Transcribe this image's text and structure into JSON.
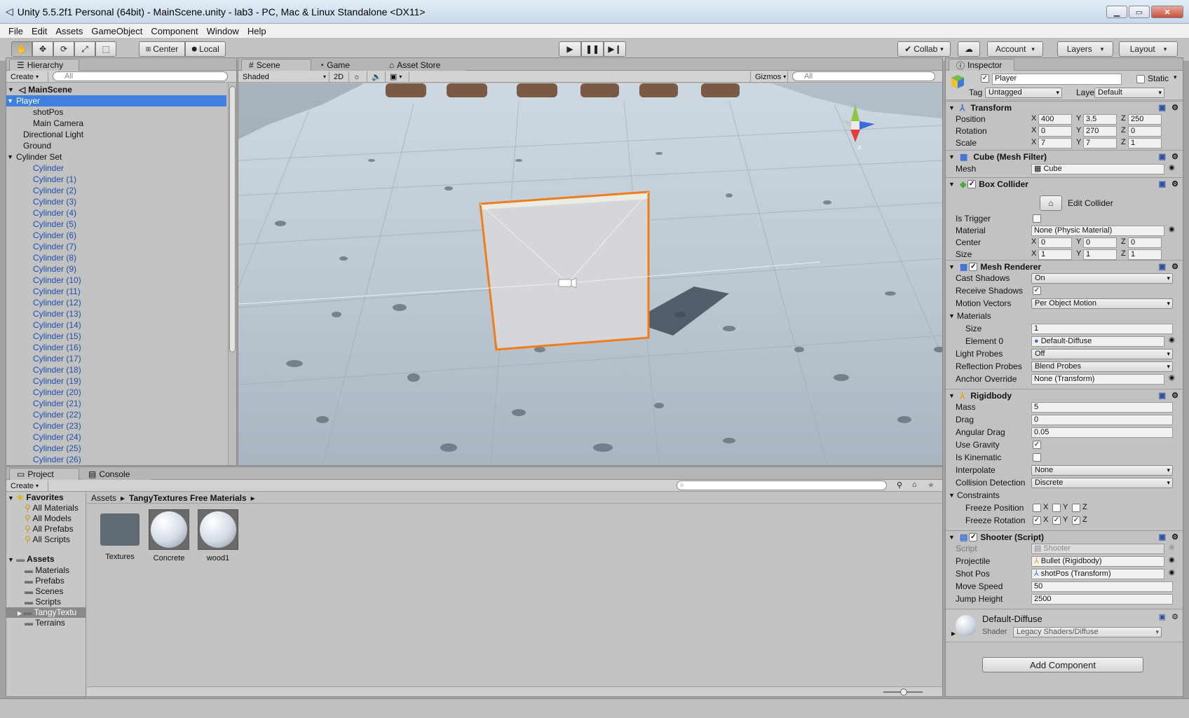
{
  "window": {
    "title": "Unity 5.5.2f1 Personal (64bit) - MainScene.unity - lab3 - PC, Mac & Linux Standalone <DX11>"
  },
  "menu": [
    "File",
    "Edit",
    "Assets",
    "GameObject",
    "Component",
    "Window",
    "Help"
  ],
  "toolbar": {
    "center": "Center",
    "local": "Local",
    "collab": "Collab",
    "account": "Account",
    "layers": "Layers",
    "layout": "Layout"
  },
  "hierarchy": {
    "tab": "Hierarchy",
    "create": "Create",
    "search_placeholder": "All",
    "scene": "MainScene",
    "items": [
      {
        "label": "Player",
        "indent": 1,
        "selected": true,
        "expanded": true
      },
      {
        "label": "shotPos",
        "indent": 2
      },
      {
        "label": "Main Camera",
        "indent": 2
      },
      {
        "label": "Directional Light",
        "indent": 1
      },
      {
        "label": "Ground",
        "indent": 1
      },
      {
        "label": "Cylinder Set",
        "indent": 1,
        "expanded": true
      },
      {
        "label": "Cylinder",
        "indent": 2,
        "prefab": true
      },
      {
        "label": "Cylinder (1)",
        "indent": 2,
        "prefab": true
      },
      {
        "label": "Cylinder (2)",
        "indent": 2,
        "prefab": true
      },
      {
        "label": "Cylinder (3)",
        "indent": 2,
        "prefab": true
      },
      {
        "label": "Cylinder (4)",
        "indent": 2,
        "prefab": true
      },
      {
        "label": "Cylinder (5)",
        "indent": 2,
        "prefab": true
      },
      {
        "label": "Cylinder (6)",
        "indent": 2,
        "prefab": true
      },
      {
        "label": "Cylinder (7)",
        "indent": 2,
        "prefab": true
      },
      {
        "label": "Cylinder (8)",
        "indent": 2,
        "prefab": true
      },
      {
        "label": "Cylinder (9)",
        "indent": 2,
        "prefab": true
      },
      {
        "label": "Cylinder (10)",
        "indent": 2,
        "prefab": true
      },
      {
        "label": "Cylinder (11)",
        "indent": 2,
        "prefab": true
      },
      {
        "label": "Cylinder (12)",
        "indent": 2,
        "prefab": true
      },
      {
        "label": "Cylinder (13)",
        "indent": 2,
        "prefab": true
      },
      {
        "label": "Cylinder (14)",
        "indent": 2,
        "prefab": true
      },
      {
        "label": "Cylinder (15)",
        "indent": 2,
        "prefab": true
      },
      {
        "label": "Cylinder (16)",
        "indent": 2,
        "prefab": true
      },
      {
        "label": "Cylinder (17)",
        "indent": 2,
        "prefab": true
      },
      {
        "label": "Cylinder (18)",
        "indent": 2,
        "prefab": true
      },
      {
        "label": "Cylinder (19)",
        "indent": 2,
        "prefab": true
      },
      {
        "label": "Cylinder (20)",
        "indent": 2,
        "prefab": true
      },
      {
        "label": "Cylinder (21)",
        "indent": 2,
        "prefab": true
      },
      {
        "label": "Cylinder (22)",
        "indent": 2,
        "prefab": true
      },
      {
        "label": "Cylinder (23)",
        "indent": 2,
        "prefab": true
      },
      {
        "label": "Cylinder (24)",
        "indent": 2,
        "prefab": true
      },
      {
        "label": "Cylinder (25)",
        "indent": 2,
        "prefab": true
      },
      {
        "label": "Cylinder (26)",
        "indent": 2,
        "prefab": true
      }
    ]
  },
  "scene": {
    "tabs": [
      "Scene",
      "Game",
      "Asset Store"
    ],
    "shading": "Shaded",
    "mode2d": "2D",
    "gizmos": "Gizmos",
    "search_placeholder": "All"
  },
  "project": {
    "tabs": [
      "Project",
      "Console"
    ],
    "create": "Create",
    "favorites_label": "Favorites",
    "favorites": [
      "All Materials",
      "All Models",
      "All Prefabs",
      "All Scripts"
    ],
    "assets_label": "Assets",
    "folders": [
      "Materials",
      "Prefabs",
      "Scenes",
      "Scripts",
      "TangyTextu",
      "Terrains"
    ],
    "breadcrumb": [
      "Assets",
      "TangyTextures Free Materials"
    ],
    "items": [
      {
        "label": "Textures",
        "kind": "folder"
      },
      {
        "label": "Concrete",
        "kind": "material"
      },
      {
        "label": "wood1",
        "kind": "material"
      }
    ]
  },
  "inspector": {
    "tab": "Inspector",
    "object": {
      "name": "Player",
      "static": "Static",
      "tag_label": "Tag",
      "tag": "Untagged",
      "layer_label": "Layer",
      "layer": "Default"
    },
    "transform": {
      "title": "Transform",
      "rows": [
        {
          "label": "Position",
          "x": "400",
          "y": "3.5",
          "z": "250"
        },
        {
          "label": "Rotation",
          "x": "0",
          "y": "270",
          "z": "0"
        },
        {
          "label": "Scale",
          "x": "7",
          "y": "7",
          "z": "1"
        }
      ]
    },
    "mesh_filter": {
      "title": "Cube (Mesh Filter)",
      "mesh_label": "Mesh",
      "mesh": "Cube"
    },
    "box_collider": {
      "title": "Box Collider",
      "edit": "Edit Collider",
      "is_trigger": "Is Trigger",
      "material_label": "Material",
      "material": "None (Physic Material)",
      "center": {
        "label": "Center",
        "x": "0",
        "y": "0",
        "z": "0"
      },
      "size": {
        "label": "Size",
        "x": "1",
        "y": "1",
        "z": "1"
      }
    },
    "mesh_renderer": {
      "title": "Mesh Renderer",
      "cast_shadows_label": "Cast Shadows",
      "cast_shadows": "On",
      "receive_shadows_label": "Receive Shadows",
      "motion_vectors_label": "Motion Vectors",
      "motion_vectors": "Per Object Motion",
      "materials_label": "Materials",
      "size_label": "Size",
      "size": "1",
      "element0_label": "Element 0",
      "element0": "Default-Diffuse",
      "light_probes_label": "Light Probes",
      "light_probes": "Off",
      "reflection_probes_label": "Reflection Probes",
      "reflection_probes": "Blend Probes",
      "anchor_override_label": "Anchor Override",
      "anchor_override": "None (Transform)"
    },
    "rigidbody": {
      "title": "Rigidbody",
      "mass_label": "Mass",
      "mass": "5",
      "drag_label": "Drag",
      "drag": "0",
      "angular_drag_label": "Angular Drag",
      "angular_drag": "0.05",
      "use_gravity_label": "Use Gravity",
      "is_kinematic_label": "Is Kinematic",
      "interpolate_label": "Interpolate",
      "interpolate": "None",
      "collision_label": "Collision Detection",
      "collision": "Discrete",
      "constraints_label": "Constraints",
      "freeze_pos_label": "Freeze Position",
      "freeze_rot_label": "Freeze Rotation",
      "axes": [
        "X",
        "Y",
        "Z"
      ]
    },
    "shooter": {
      "title": "Shooter (Script)",
      "script_label": "Script",
      "script": "Shooter",
      "projectile_label": "Projectile",
      "projectile": "Bullet (Rigidbody)",
      "shotpos_label": "Shot Pos",
      "shotpos": "shotPos (Transform)",
      "move_speed_label": "Move Speed",
      "move_speed": "50",
      "jump_height_label": "Jump Height",
      "jump_height": "2500"
    },
    "material": {
      "name": "Default-Diffuse",
      "shader_label": "Shader",
      "shader": "Legacy Shaders/Diffuse"
    },
    "add_component": "Add Component"
  }
}
